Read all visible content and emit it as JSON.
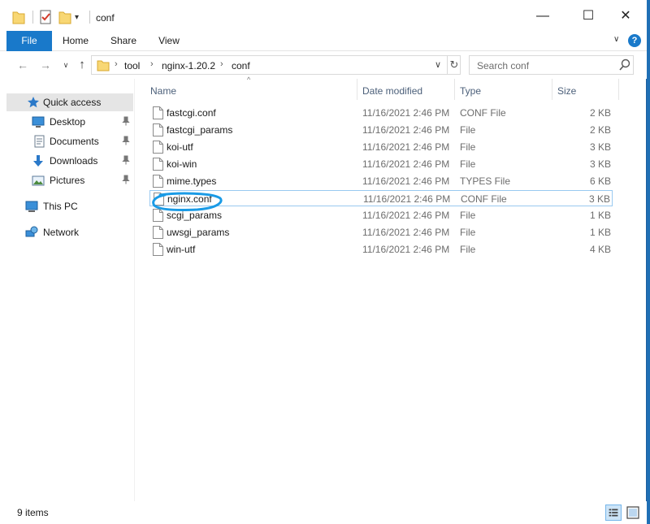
{
  "window": {
    "title": "conf"
  },
  "ribbon": {
    "tabs": [
      {
        "label": "File"
      },
      {
        "label": "Home"
      },
      {
        "label": "Share"
      },
      {
        "label": "View"
      }
    ]
  },
  "address": {
    "crumbs": [
      "tool",
      "nginx-1.20.2",
      "conf"
    ]
  },
  "search": {
    "placeholder": "Search conf"
  },
  "sidebar": {
    "items": [
      {
        "label": "Quick access",
        "icon": "star-icon"
      },
      {
        "label": "Desktop",
        "icon": "desktop-icon",
        "pinned": true
      },
      {
        "label": "Documents",
        "icon": "documents-icon",
        "pinned": true
      },
      {
        "label": "Downloads",
        "icon": "downloads-icon",
        "pinned": true
      },
      {
        "label": "Pictures",
        "icon": "pictures-icon",
        "pinned": true
      },
      {
        "label": "This PC",
        "icon": "computer-icon"
      },
      {
        "label": "Network",
        "icon": "network-icon"
      }
    ]
  },
  "columns": [
    "Name",
    "Date modified",
    "Type",
    "Size"
  ],
  "files": [
    {
      "name": "fastcgi.conf",
      "date": "11/16/2021 2:46 PM",
      "type": "CONF File",
      "size": "2 KB"
    },
    {
      "name": "fastcgi_params",
      "date": "11/16/2021 2:46 PM",
      "type": "File",
      "size": "2 KB"
    },
    {
      "name": "koi-utf",
      "date": "11/16/2021 2:46 PM",
      "type": "File",
      "size": "3 KB"
    },
    {
      "name": "koi-win",
      "date": "11/16/2021 2:46 PM",
      "type": "File",
      "size": "3 KB"
    },
    {
      "name": "mime.types",
      "date": "11/16/2021 2:46 PM",
      "type": "TYPES File",
      "size": "6 KB"
    },
    {
      "name": "nginx.conf",
      "date": "11/16/2021 2:46 PM",
      "type": "CONF File",
      "size": "3 KB"
    },
    {
      "name": "scgi_params",
      "date": "11/16/2021 2:46 PM",
      "type": "File",
      "size": "1 KB"
    },
    {
      "name": "uwsgi_params",
      "date": "11/16/2021 2:46 PM",
      "type": "File",
      "size": "1 KB"
    },
    {
      "name": "win-utf",
      "date": "11/16/2021 2:46 PM",
      "type": "File",
      "size": "4 KB"
    }
  ],
  "status": {
    "item_count": "9 items"
  },
  "colors": {
    "accent": "#1979ca",
    "annotation": "#1a9be6",
    "desktop": "#1f6fb5"
  }
}
